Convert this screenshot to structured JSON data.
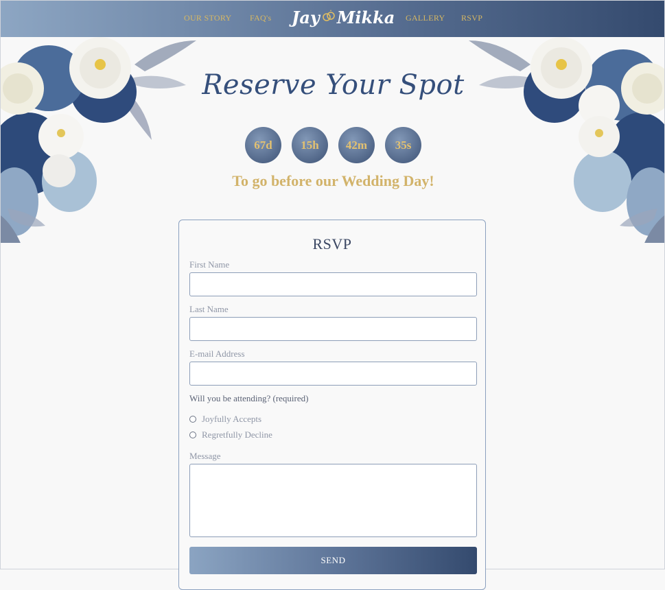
{
  "nav": {
    "links_left": [
      "OUR STORY",
      "FAQ's"
    ],
    "brand": {
      "left": "Jay",
      "right": "Mikka",
      "icon": "wedding-rings-icon"
    },
    "links_right": [
      "GALLERY",
      "RSVP"
    ]
  },
  "hero": {
    "title": "Reserve Your Spot",
    "countdown": [
      "67d",
      "15h",
      "42m",
      "35s"
    ],
    "tagline": "To go before our Wedding Day!"
  },
  "rsvp_form": {
    "title": "RSVP",
    "first_name": {
      "label": "First Name",
      "value": ""
    },
    "last_name": {
      "label": "Last Name",
      "value": ""
    },
    "email": {
      "label": "E-mail Address",
      "value": ""
    },
    "attending": {
      "question": "Will you be attending? (required)",
      "options": [
        "Joyfully Accepts",
        "Regretfully Decline"
      ]
    },
    "message": {
      "label": "Message",
      "value": ""
    },
    "send_label": "SEND"
  },
  "colors": {
    "navy": "#354f7b",
    "gold": "#d2b36a",
    "nav_gradient_start": "#8da6c3",
    "nav_gradient_end": "#344a6e"
  }
}
